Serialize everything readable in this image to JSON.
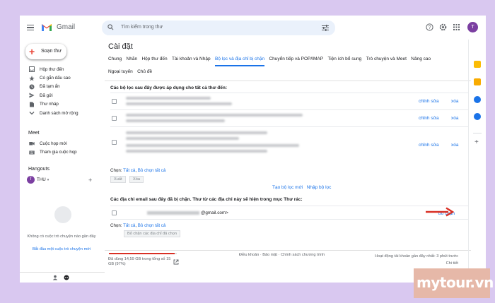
{
  "header": {
    "app_name": "Gmail",
    "search_placeholder": "Tìm kiếm trong thư",
    "avatar_letter": "T"
  },
  "sidebar": {
    "compose_label": "Soạn thư",
    "items": [
      {
        "label": "Hộp thư đến",
        "icon": "inbox-icon"
      },
      {
        "label": "Có gắn dấu sao",
        "icon": "star-icon"
      },
      {
        "label": "Đã tạm ẩn",
        "icon": "clock-icon"
      },
      {
        "label": "Đã gửi",
        "icon": "send-icon"
      },
      {
        "label": "Thư nháp",
        "icon": "draft-icon"
      },
      {
        "label": "Danh sách mở rộng",
        "icon": "chevron-down-icon"
      }
    ],
    "meet_title": "Meet",
    "meet_items": [
      {
        "label": "Cuộc họp mới",
        "icon": "video-icon"
      },
      {
        "label": "Tham gia cuộc họp",
        "icon": "keyboard-icon"
      }
    ],
    "hangouts_title": "Hangouts",
    "hangouts_user": "THU",
    "hangouts_avatar": "T",
    "hangouts_empty": "Không có cuộc trò chuyện nào gần đây",
    "hangouts_link": "Bắt đầu một cuộc trò chuyện mới"
  },
  "settings": {
    "title": "Cài đặt",
    "tabs_row1": [
      "Chung",
      "Nhãn",
      "Hộp thư đến",
      "Tài khoản và Nhập",
      "Bộ lọc và địa chỉ bị chặn",
      "Chuyển tiếp và POP/IMAP",
      "Tiện ích bổ sung",
      "Trò chuyện và Meet",
      "Nâng cao"
    ],
    "tabs_row2": [
      "Ngoại tuyến",
      "Chủ đề"
    ],
    "active_tab": "Bộ lọc và địa chỉ bị chặn",
    "filters_title": "Các bộ lọc sau đây được áp dụng cho tất cả thư đến:",
    "edit_label": "chỉnh sửa",
    "delete_label": "xóa",
    "select_label": "Chọn:",
    "select_all": "Tất cả",
    "select_none": "Bỏ chọn tất cả",
    "export_button": "Xuất",
    "delete_button": "Xóa",
    "create_filter": "Tạo bộ lọc mới",
    "import_filter": "Nhập bộ lọc",
    "blocked_title": "Các địa chỉ email sau đây đã bị chặn. Thư từ các địa chỉ này sẽ hiện trong mục Thư rác:",
    "blocked_email_suffix": "@gmail.com>",
    "unblock_label": "bỏ chặn",
    "unblock_selected": "Bỏ chặn các địa chỉ đã chọn"
  },
  "footer": {
    "storage_text": "Đã dùng 14,59 GB trong tổng số 15 GB (97%)",
    "storage_percent": 97,
    "links": "Điều khoản · Bảo mật · Chính sách chương trình",
    "activity": "Hoạt động tài khoản gần đây nhất: 3 phút trước",
    "details": "Chi tiết"
  },
  "watermark": "mytour.vn",
  "colors": {
    "accent": "#1a73e8",
    "arrow": "#d93025",
    "frame_bg": "#d9c8f0"
  }
}
